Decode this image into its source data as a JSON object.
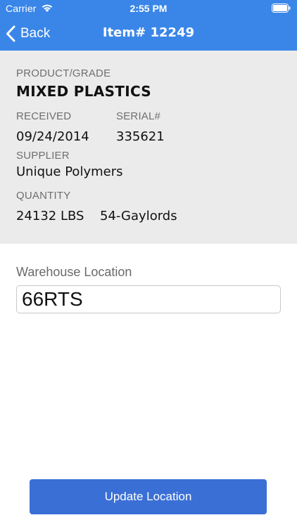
{
  "status_bar": {
    "carrier": "Carrier",
    "time": "2:55 PM",
    "wifi_icon": "wifi-icon",
    "battery_icon": "battery-icon"
  },
  "nav": {
    "back_label": "Back",
    "back_icon": "chevron-left-icon",
    "title": "Item# 12249",
    "bar_color": "#3a86e8"
  },
  "details": {
    "product_grade_label": "PRODUCT/GRADE",
    "product_grade_value": "MIXED PLASTICS",
    "received_label": "RECEIVED",
    "received_value": "09/24/2014",
    "serial_label": "SERIAL#",
    "serial_value": "335621",
    "supplier_label": "SUPPLIER",
    "supplier_value": "Unique Polymers",
    "quantity_label": "QUANTITY",
    "quantity_weight": "24132 LBS",
    "quantity_containers": "54-Gaylords"
  },
  "location": {
    "label": "Warehouse Location",
    "value": "66RTS"
  },
  "actions": {
    "update_label": "Update Location",
    "button_color": "#3a6fd6"
  }
}
